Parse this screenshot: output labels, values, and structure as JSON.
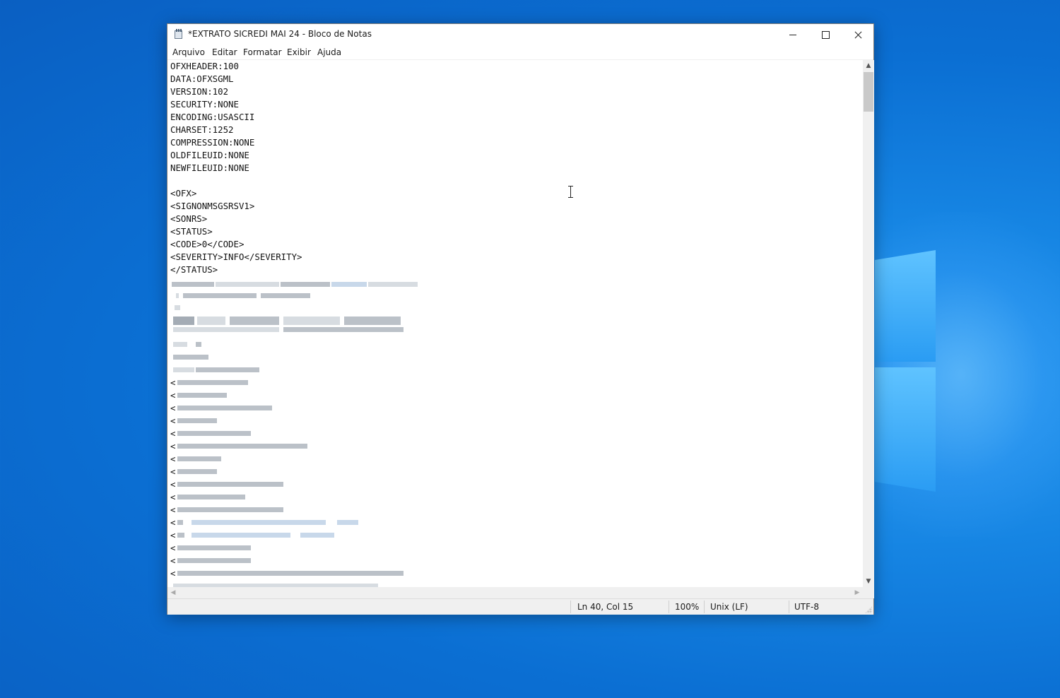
{
  "window": {
    "title": "*EXTRATO SICREDI MAI 24 - Bloco de Notas",
    "app_icon": "notepad-icon",
    "caption_icons": [
      "minimize-icon",
      "maximize-icon",
      "close-icon"
    ]
  },
  "menu": [
    "Arquivo",
    "Editar",
    "Formatar",
    "Exibir",
    "Ajuda"
  ],
  "editor": {
    "lines": [
      "OFXHEADER:100",
      "DATA:OFXSGML",
      "VERSION:102",
      "SECURITY:NONE",
      "ENCODING:USASCII",
      "CHARSET:1252",
      "COMPRESSION:NONE",
      "OLDFILEUID:NONE",
      "NEWFILEUID:NONE",
      "",
      "<OFX>",
      "<SIGNONMSGSRSV1>",
      "<SONRS>",
      "<STATUS>",
      "<CODE>0</CODE>",
      "<SEVERITY>INFO</SEVERITY>",
      "</STATUS>"
    ],
    "redacted_prefix": "<"
  },
  "statusbar": {
    "position": "Ln 40, Col 15",
    "zoom": "100%",
    "line_ending": "Unix (LF)",
    "encoding": "UTF-8"
  },
  "colors": {
    "desktop": "#0b6fd3",
    "window_bg": "#ffffff",
    "statusbar_bg": "#f0f0f0"
  }
}
